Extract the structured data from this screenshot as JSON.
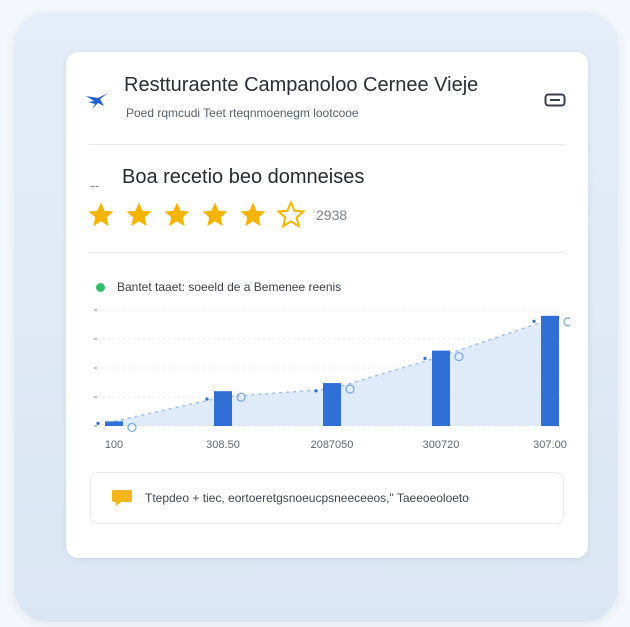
{
  "card": {
    "title": "Restturaente Campanoloo Cernee Vieje",
    "subtitle": "Poed rqmcudi Teet rteqnmoenegm lootcooe",
    "logo_icon": "bird-logo-icon",
    "menu_icon": "expand-icon"
  },
  "rating": {
    "dash": "--",
    "heading": "Boa recetio beo domneises",
    "stars_full": 5,
    "stars_half": 1,
    "count": "2938",
    "star_color": "#f4b400"
  },
  "chart_legend": {
    "label": "Bantet taaet: soeeld de a Bemenee reenis",
    "dot_color": "#2fbf6b"
  },
  "chart_data": {
    "type": "bar",
    "categories": [
      "100",
      "308.50",
      "2087050",
      "300720",
      "307.00"
    ],
    "values": [
      4,
      30,
      37,
      65,
      95
    ],
    "trend": [
      4,
      25,
      32,
      60,
      92
    ],
    "ylim": [
      0,
      100
    ],
    "bar_color": "#2f6fd6",
    "area_color": "#d7e6f8",
    "ytick_labels": [
      "",
      "",
      "",
      "",
      ""
    ],
    "grid": true
  },
  "note": {
    "icon": "chat-bubble-icon",
    "text": "Ttepdeo + tiec, eortoeretgsnoeucpsneeceeos,\" Taeeoeoloeto",
    "icon_color": "#f2b51c"
  }
}
